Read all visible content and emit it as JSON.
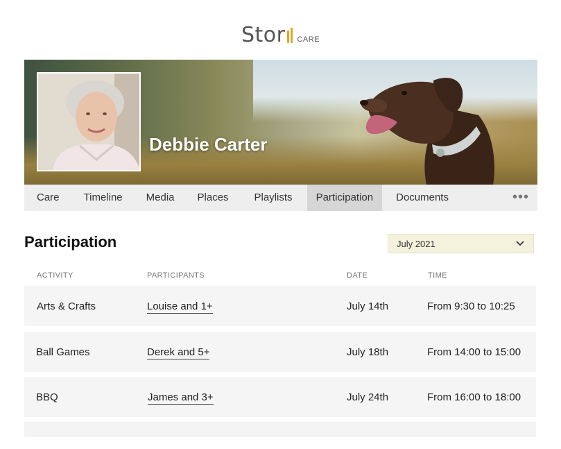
{
  "logo": {
    "word": "Stor",
    "suffix": "CARE",
    "accent": "#e1a626"
  },
  "profile": {
    "name": "Debbie Carter"
  },
  "tabs": [
    {
      "label": "Care"
    },
    {
      "label": "Timeline"
    },
    {
      "label": "Media"
    },
    {
      "label": "Places"
    },
    {
      "label": "Playlists"
    },
    {
      "label": "Participation",
      "active": true
    },
    {
      "label": "Documents"
    }
  ],
  "tabs_more": "•••",
  "section": {
    "title": "Participation",
    "month": "July 2021"
  },
  "columns": {
    "activity": "ACTIVITY",
    "participants": "PARTICIPANTS",
    "date": "DATE",
    "time": "TIME"
  },
  "rows": [
    {
      "activity": "Arts & Crafts",
      "participants": "Louise and 1+",
      "date": "July 14th",
      "time": "From 9:30 to 10:25"
    },
    {
      "activity": "Ball Games",
      "participants": "Derek and 5+",
      "date": "July 18th",
      "time": "From 14:00 to 15:00"
    },
    {
      "activity": "BBQ",
      "participants": "James and 3+",
      "date": "July 24th",
      "time": "From 16:00 to 18:00"
    }
  ]
}
